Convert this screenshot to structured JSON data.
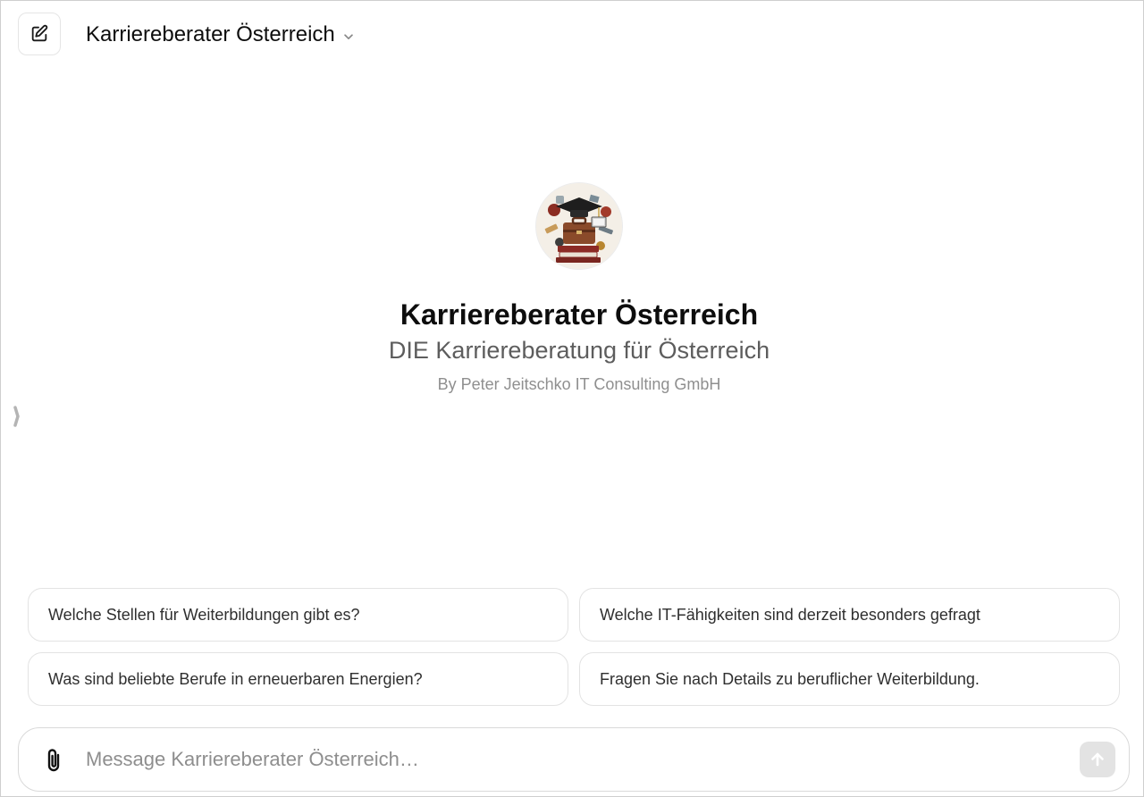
{
  "header": {
    "title": "Karriereberater Österreich",
    "new_chat_icon": "edit-pencil-square-icon",
    "dropdown_icon": "chevron-down-icon"
  },
  "sidebar": {
    "toggle_icon": "chevron-right-handle-icon"
  },
  "hero": {
    "avatar": "gpt-avatar-image",
    "title": "Karriereberater Österreich",
    "subtitle": "DIE Karriereberatung für Österreich",
    "author": "By Peter Jeitschko IT Consulting GmbH"
  },
  "suggestions": [
    {
      "text": "Welche Stellen für Weiterbildungen gibt es?"
    },
    {
      "text": "Welche IT-Fähigkeiten sind derzeit besonders gefragt"
    },
    {
      "text": "Was sind beliebte Berufe in erneuerbaren Energien?"
    },
    {
      "text": "Fragen Sie nach Details zu beruflicher Weiterbildung."
    }
  ],
  "composer": {
    "value": "",
    "placeholder": "Message Karriereberater Österreich…",
    "attach_icon": "paperclip-icon",
    "send_icon": "arrow-up-icon"
  },
  "colors": {
    "text_primary": "#0d0d0d",
    "text_secondary": "#5d5d5d",
    "text_muted": "#8f8f8f",
    "border": "#e3e3e3",
    "send_disabled_bg": "#e3e3e3"
  }
}
